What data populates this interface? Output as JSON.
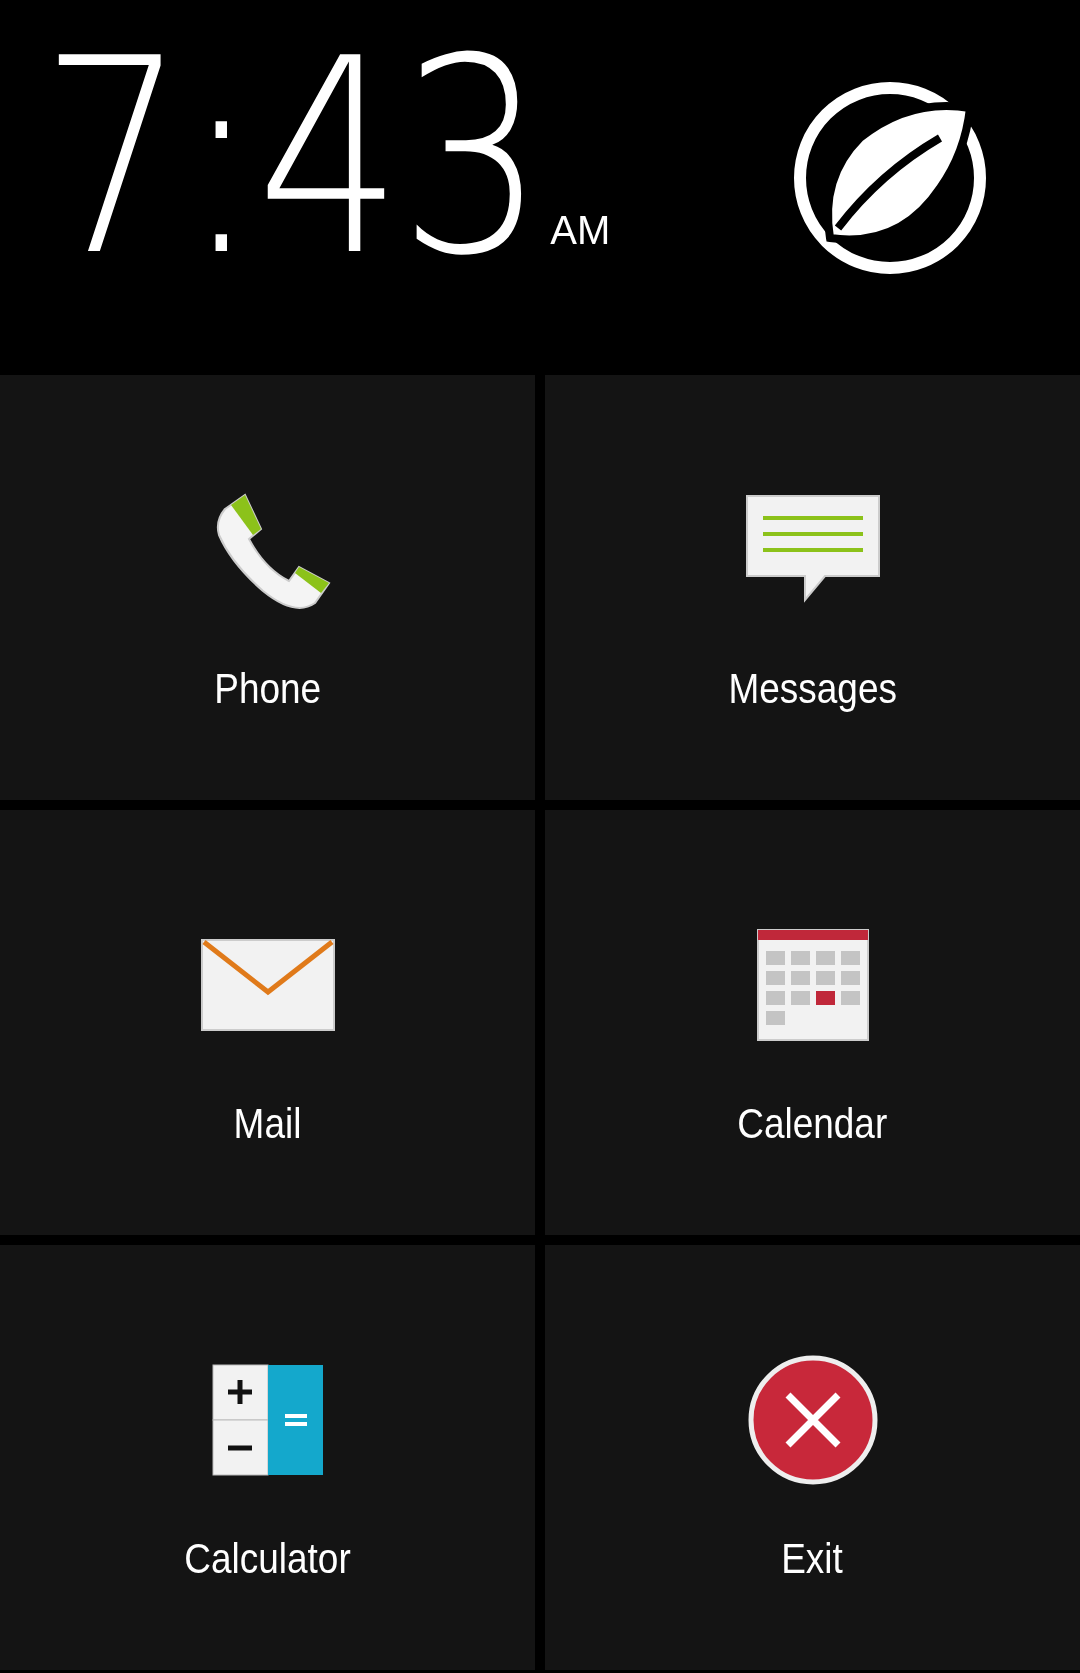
{
  "clock": {
    "time": "7:43",
    "period": "AM"
  },
  "tiles": [
    {
      "label": "Phone",
      "kind": "phone"
    },
    {
      "label": "Messages",
      "kind": "messages"
    },
    {
      "label": "Mail",
      "kind": "mail"
    },
    {
      "label": "Calendar",
      "kind": "calendar"
    },
    {
      "label": "Calculator",
      "kind": "calculator"
    },
    {
      "label": "Exit",
      "kind": "exit"
    }
  ]
}
